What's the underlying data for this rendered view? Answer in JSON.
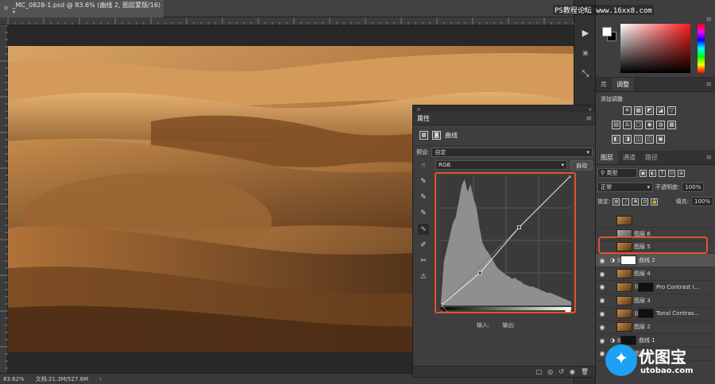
{
  "document": {
    "tab_title": "_MC_0828-1.psd @ 83.6% (曲线 2, 图层蒙版/16) *",
    "close_glyph": "×"
  },
  "status": {
    "zoom": "83.62%",
    "doc_size": "文档:21.3M/527.8M",
    "arrow": "›"
  },
  "watermark": {
    "top_text": "PS教程论坛 www.16xx8.com",
    "logo_cn": "优图宝",
    "logo_en": "utobao.com",
    "logo_glyph": "✦"
  },
  "icon_strip": {
    "tools": [
      {
        "name": "collapse-icon",
        "glyph": "»"
      },
      {
        "name": "play-icon",
        "glyph": "▶"
      },
      {
        "name": "settings-gear-icon",
        "glyph": "✳"
      },
      {
        "name": "transform-icon",
        "glyph": "⤡"
      }
    ]
  },
  "color_panel": {
    "menu": "≡",
    "foreground": "#ffffff",
    "background": "#000000"
  },
  "adjust_panel": {
    "tabs": [
      "库",
      "调整"
    ],
    "active_tab": 1,
    "menu": "≡",
    "add_label": "添加调整",
    "row1": [
      "☀",
      "▦",
      "◩",
      "◪",
      "▽"
    ],
    "row2": [
      "▤",
      "♎",
      "□",
      "◉",
      "◍",
      "▦"
    ],
    "row3": [
      "◧",
      "◨",
      "◫",
      "◰",
      "▣"
    ]
  },
  "layers_panel": {
    "tabs": [
      "图层",
      "通道",
      "路径"
    ],
    "active_tab": 0,
    "menu": "≡",
    "filter_kind": "⚲ 类型",
    "filter_icons": [
      "▣",
      "◐",
      "T",
      "⊡",
      "⊕"
    ],
    "blend_mode": "正常",
    "opacity_label": "不透明度:",
    "opacity_value": "100%",
    "lock_label": "锁定:",
    "lock_icons": [
      "⊠",
      "∕",
      "✥",
      "⊡",
      "🔒"
    ],
    "fill_label": "填充:",
    "fill_value": "100%",
    "dropdown_arrow": "▾",
    "layers": [
      {
        "name": "",
        "visible": false,
        "type": "pixel",
        "thumb": "color"
      },
      {
        "name": "图层 6",
        "visible": false,
        "type": "pixel",
        "thumb": "gray"
      },
      {
        "name": "图层 5",
        "visible": false,
        "type": "pixel",
        "thumb": "color"
      },
      {
        "name": "曲线 2",
        "visible": true,
        "type": "curves",
        "mask": "white",
        "selected": true
      },
      {
        "name": "图层 4",
        "visible": true,
        "type": "pixel",
        "thumb": "color"
      },
      {
        "name": "Pro Contrast (...",
        "visible": true,
        "type": "smart",
        "thumb": "color",
        "mask": "dark"
      },
      {
        "name": "图层 3",
        "visible": true,
        "type": "pixel",
        "thumb": "color"
      },
      {
        "name": "Tonal Contras...",
        "visible": true,
        "type": "smart",
        "thumb": "color",
        "mask": "dark"
      },
      {
        "name": "图层 2",
        "visible": true,
        "type": "pixel",
        "thumb": "color"
      },
      {
        "name": "曲线 1",
        "visible": true,
        "type": "curves",
        "mask": "dark"
      },
      {
        "name": "图层 1",
        "visible": true,
        "type": "pixel",
        "thumb": "color"
      }
    ],
    "eye_glyph": "◉",
    "link_glyph": "⛓",
    "adj_glyph": "◑"
  },
  "properties_panel": {
    "title": "属性",
    "collapse": "«",
    "close": "×",
    "menu": "≡",
    "type_label": "曲线",
    "type_icons": [
      "▦",
      "◙"
    ],
    "preset_label": "预设:",
    "preset_value": "自定",
    "channel": "RGB",
    "auto_button": "自动",
    "dropdown_arrow": "▾",
    "tools": [
      "☝",
      "✎",
      "✎",
      "✎",
      "∿",
      "✐",
      "✂",
      "⚠"
    ],
    "input_label": "输入:",
    "output_label": "输出:",
    "bottom_icons": [
      "▢",
      "◎",
      "↺",
      "◉",
      "🗑"
    ],
    "curve_points": [
      [
        0,
        0
      ],
      [
        0.3,
        0.25
      ],
      [
        0.6,
        0.6
      ],
      [
        1,
        1
      ]
    ],
    "histogram": [
      0.02,
      0.35,
      0.45,
      0.55,
      0.65,
      0.7,
      0.82,
      0.95,
      1.0,
      0.9,
      0.96,
      0.85,
      0.78,
      0.62,
      0.5,
      0.45,
      0.42,
      0.38,
      0.34,
      0.3,
      0.28,
      0.26,
      0.24,
      0.23,
      0.21,
      0.22,
      0.2,
      0.19,
      0.17,
      0.16,
      0.15,
      0.15,
      0.14,
      0.13,
      0.12,
      0.11,
      0.1,
      0.1,
      0.09,
      0.08,
      0.07,
      0.06,
      0.05,
      0.04,
      0.03
    ]
  }
}
